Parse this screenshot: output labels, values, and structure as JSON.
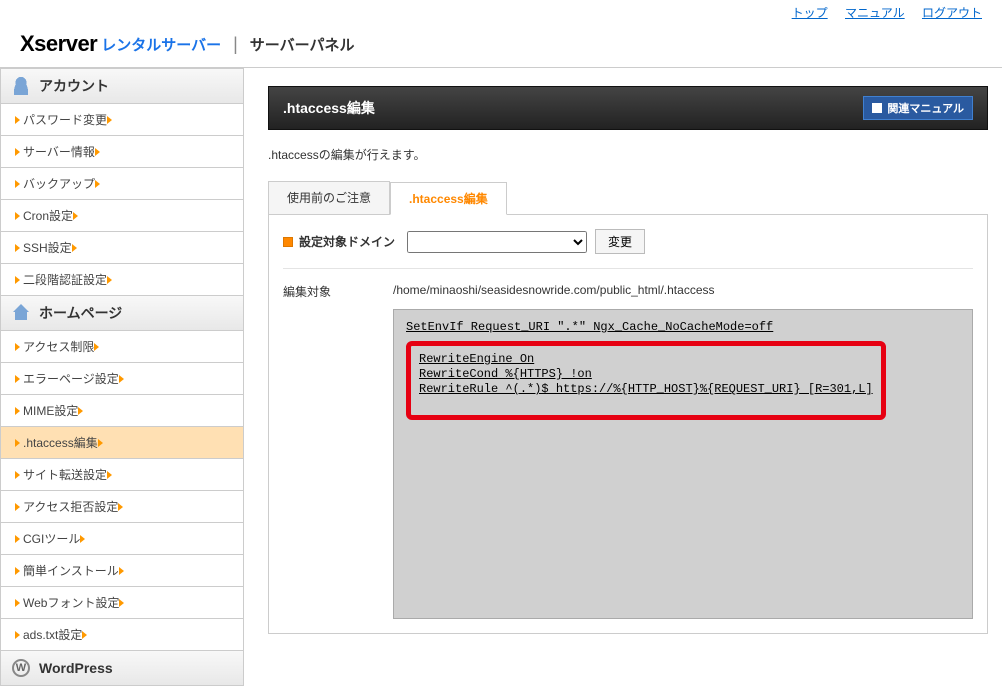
{
  "topLinks": {
    "top": "トップ",
    "manual": "マニュアル",
    "logout": "ログアウト"
  },
  "logo": {
    "brand": "Xserver",
    "rental": "レンタルサーバー",
    "panel": "サーバーパネル"
  },
  "sidebar": {
    "sections": [
      {
        "title": "アカウント",
        "icon": "person",
        "items": [
          {
            "label": "パスワード変更"
          },
          {
            "label": "サーバー情報"
          },
          {
            "label": "バックアップ"
          },
          {
            "label": "Cron設定"
          },
          {
            "label": "SSH設定"
          },
          {
            "label": "二段階認証設定"
          }
        ]
      },
      {
        "title": "ホームページ",
        "icon": "house",
        "items": [
          {
            "label": "アクセス制限"
          },
          {
            "label": "エラーページ設定"
          },
          {
            "label": "MIME設定"
          },
          {
            "label": ".htaccess編集",
            "active": true
          },
          {
            "label": "サイト転送設定"
          },
          {
            "label": "アクセス拒否設定"
          },
          {
            "label": "CGIツール"
          },
          {
            "label": "簡単インストール"
          },
          {
            "label": "Webフォント設定"
          },
          {
            "label": "ads.txt設定"
          }
        ]
      },
      {
        "title": "WordPress",
        "icon": "wordpress",
        "items": []
      }
    ]
  },
  "page": {
    "title": ".htaccess編集",
    "relatedManual": "関連マニュアル",
    "description": ".htaccessの編集が行えます。",
    "tabs": [
      {
        "label": "使用前のご注意",
        "active": false
      },
      {
        "label": ".htaccess編集",
        "active": true
      }
    ],
    "domain": {
      "label": "設定対象ドメイン",
      "selected": "",
      "changeButton": "変更"
    },
    "edit": {
      "label": "編集対象",
      "path": "/home/minaoshi/seasidesnowride.com/public_html/.htaccess",
      "line1": "SetEnvIf Request_URI \".*\" Ngx_Cache_NoCacheMode=off",
      "codeBlock": "RewriteEngine On\nRewriteCond %{HTTPS} !on\nRewriteRule ^(.*)$ https://%{HTTP_HOST}%{REQUEST_URI} [R=301,L]"
    }
  }
}
